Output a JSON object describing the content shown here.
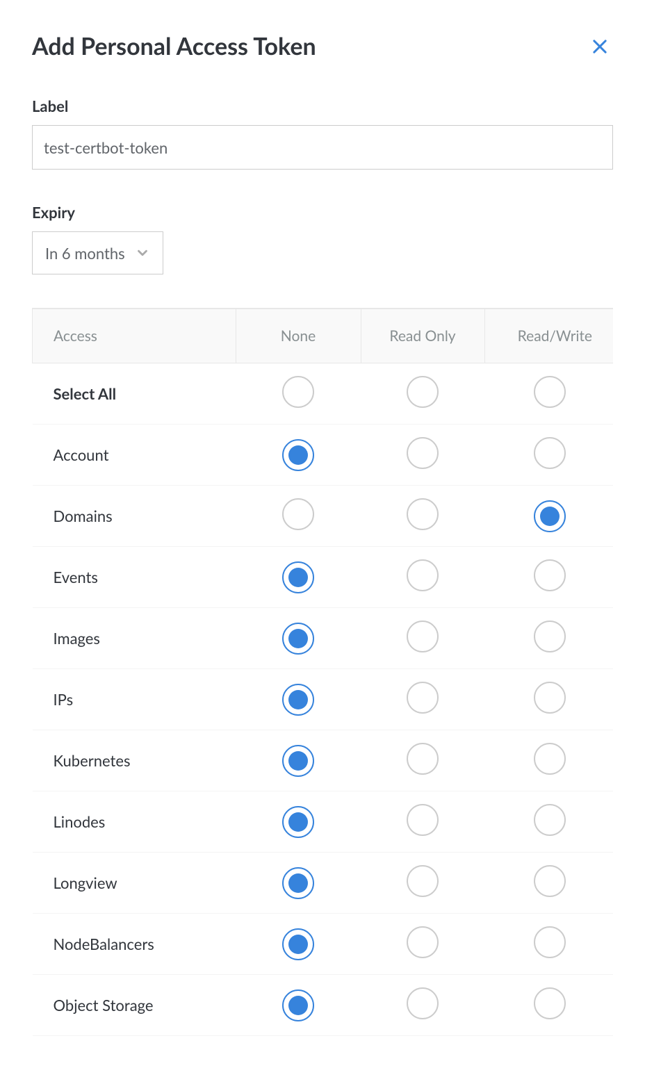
{
  "header": {
    "title": "Add Personal Access Token"
  },
  "fields": {
    "label": {
      "label": "Label",
      "value": "test-certbot-token"
    },
    "expiry": {
      "label": "Expiry",
      "selected": "In 6 months"
    }
  },
  "table": {
    "columns": {
      "access": "Access",
      "none": "None",
      "read_only": "Read Only",
      "read_write": "Read/Write"
    },
    "rows": [
      {
        "label": "Select All",
        "selected": null
      },
      {
        "label": "Account",
        "selected": "none"
      },
      {
        "label": "Domains",
        "selected": "read_write"
      },
      {
        "label": "Events",
        "selected": "none"
      },
      {
        "label": "Images",
        "selected": "none"
      },
      {
        "label": "IPs",
        "selected": "none"
      },
      {
        "label": "Kubernetes",
        "selected": "none"
      },
      {
        "label": "Linodes",
        "selected": "none"
      },
      {
        "label": "Longview",
        "selected": "none"
      },
      {
        "label": "NodeBalancers",
        "selected": "none"
      },
      {
        "label": "Object Storage",
        "selected": "none"
      }
    ]
  }
}
